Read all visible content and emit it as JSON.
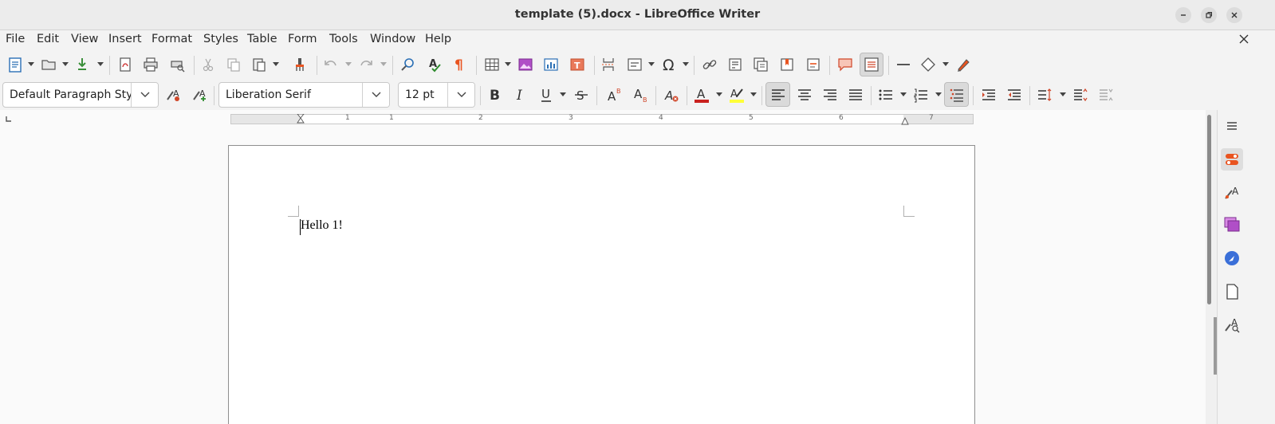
{
  "window": {
    "title": "template (5).docx - LibreOffice Writer"
  },
  "menubar": {
    "items": [
      "File",
      "Edit",
      "View",
      "Insert",
      "Format",
      "Styles",
      "Table",
      "Form",
      "Tools",
      "Window",
      "Help"
    ]
  },
  "formatting": {
    "paragraph_style": "Default Paragraph Styl",
    "font_name": "Liberation Serif",
    "font_size": "12 pt"
  },
  "ruler": {
    "labels": [
      "1",
      "1",
      "2",
      "3",
      "4",
      "5",
      "6",
      "7"
    ]
  },
  "document": {
    "text": "Hello 1!"
  },
  "colors": {
    "font_color": "#c9211e",
    "highlight_color": "#ffff38",
    "accent": "#e95420"
  }
}
